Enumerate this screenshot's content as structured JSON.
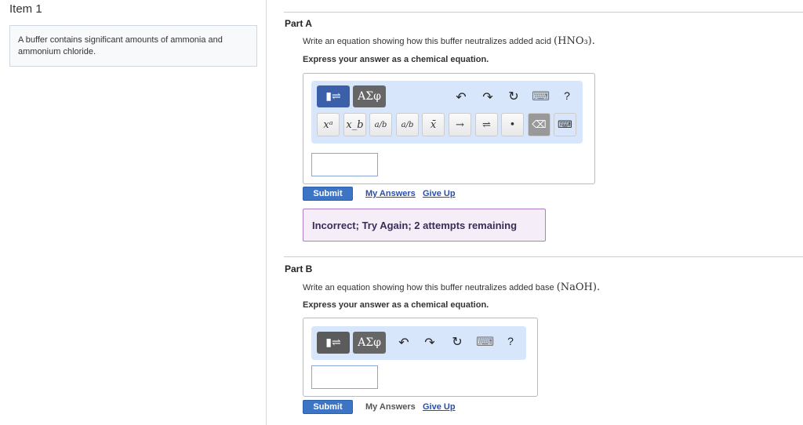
{
  "item": {
    "title": "Item 1",
    "question": "A buffer contains significant amounts of ammonia and ammonium chloride."
  },
  "partA": {
    "label": "Part A",
    "prompt": "Write an equation showing how this buffer neutralizes added acid",
    "chem": "(HNO₃).",
    "express": "Express your answer as a chemical equation.",
    "greek": "ΑΣφ",
    "symbols": [
      "xᵃ",
      "x_b",
      "a/b",
      "a/b",
      "x̄",
      "→",
      "⇌",
      "•"
    ],
    "submit": "Submit",
    "my_answers": "My Answers",
    "give_up": "Give Up",
    "feedback": "Incorrect; Try Again; 2 attempts remaining",
    "input_value": ""
  },
  "partB": {
    "label": "Part B",
    "prompt": "Write an equation showing how this buffer neutralizes added base",
    "chem": "(NaOH).",
    "express": "Express your answer as a chemical equation.",
    "greek": "ΑΣφ",
    "submit": "Submit",
    "my_answers": "My Answers",
    "give_up": "Give Up",
    "input_value": ""
  },
  "icons": {
    "undo": "↶",
    "redo": "↷",
    "reset": "↻",
    "keyboard": "⌨",
    "help": "?"
  }
}
